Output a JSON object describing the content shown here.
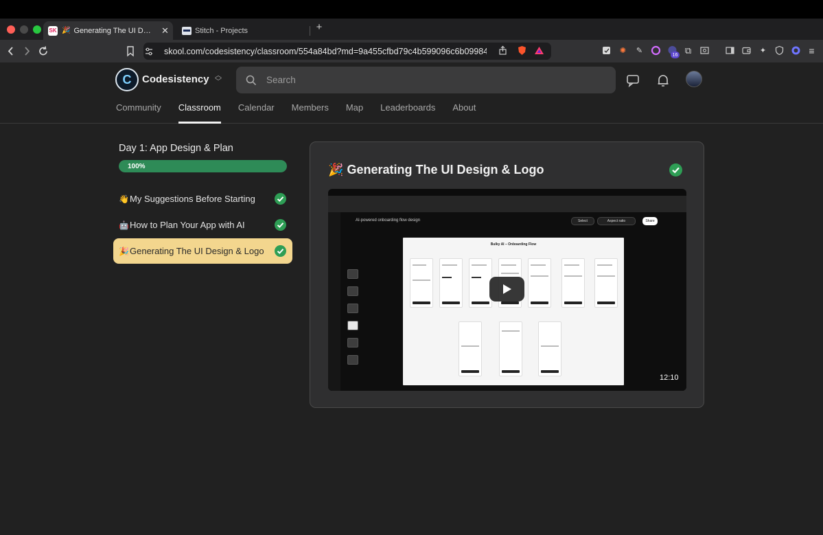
{
  "browser": {
    "tabs": [
      {
        "favicon": "SK",
        "emoji": "🎉",
        "title": "Generating The UI Design & Logo",
        "active": true
      },
      {
        "favicon": "stitch-icon",
        "title": "Stitch - Projects",
        "active": false
      }
    ],
    "new_tab": "+",
    "url": "skool.com/codesistency/classroom/554a84bd?md=9a455cfbd79c4b599096c6b09984...",
    "ext_badge": "16"
  },
  "header": {
    "logo_letter": "C",
    "community_name": "Codesistency",
    "search_placeholder": "Search"
  },
  "nav": {
    "items": [
      "Community",
      "Classroom",
      "Calendar",
      "Members",
      "Map",
      "Leaderboards",
      "About"
    ],
    "active": "Classroom"
  },
  "course": {
    "title": "Day 1: App Design & Plan",
    "progress_percent": 100,
    "progress_label": "100%",
    "lessons": [
      {
        "emoji": "👋",
        "label": "My Suggestions Before Starting",
        "completed": true,
        "active": false
      },
      {
        "emoji": "🤖",
        "label": "How to Plan Your App with AI",
        "completed": true,
        "active": false
      },
      {
        "emoji": "🎉",
        "label": "Generating The UI Design & Logo",
        "completed": true,
        "active": true
      }
    ]
  },
  "lesson_view": {
    "emoji": "🎉",
    "title": "Generating The UI Design & Logo",
    "completed": true,
    "video": {
      "app_title": "AI-powered onboarding flow design",
      "canvas_title": "Bulky AI – Onboarding Flow",
      "select_label": "Select",
      "aspect_label": "Aspect ratio",
      "share_label": "Share",
      "duration": "12:10"
    }
  },
  "colors": {
    "accent_active_lesson": "#f3d68e",
    "progress": "#2e8b57",
    "check": "#2e9e55"
  }
}
